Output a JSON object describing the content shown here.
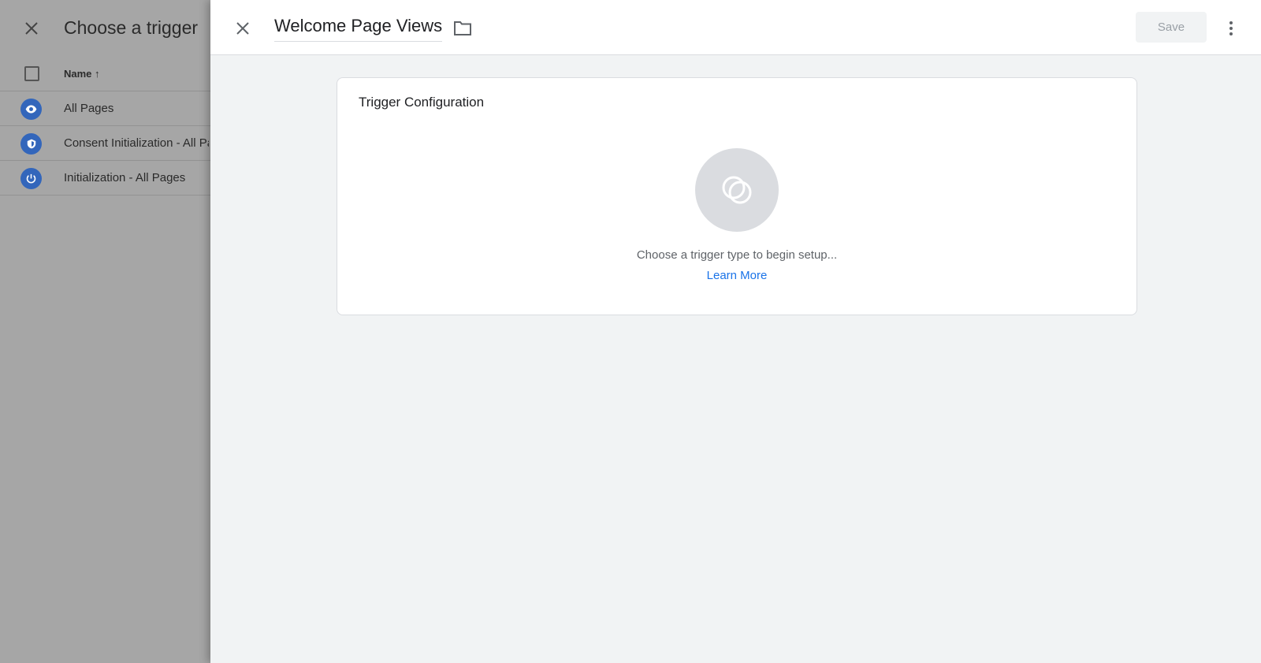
{
  "left_panel": {
    "title": "Choose a trigger",
    "column_header": "Name",
    "sort_icon": "arrow-up-icon",
    "rows": [
      {
        "label": "All Pages",
        "icon": "eye-icon"
      },
      {
        "label": "Consent Initialization - All Pages",
        "icon": "shield-icon"
      },
      {
        "label": "Initialization - All Pages",
        "icon": "power-icon"
      }
    ]
  },
  "editor": {
    "title": "Welcome Page Views",
    "save_label": "Save",
    "card": {
      "title": "Trigger Configuration",
      "hint": "Choose a trigger type to begin setup...",
      "learn_more": "Learn More"
    }
  },
  "colors": {
    "accent": "#1a73e8",
    "icon_bg": "#3366bb"
  }
}
